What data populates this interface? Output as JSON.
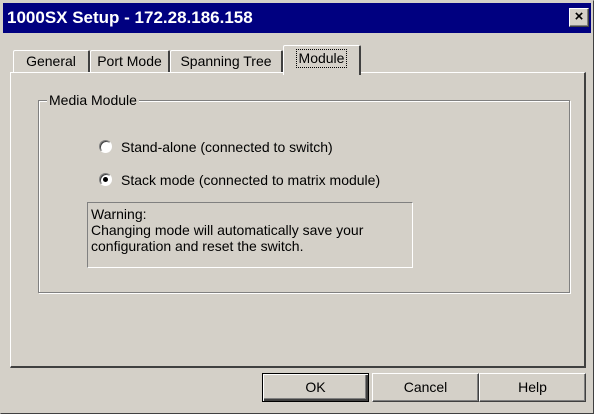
{
  "window": {
    "title": "1000SX Setup - 172.28.186.158",
    "close_glyph": "×"
  },
  "tabs": [
    {
      "label": "General",
      "active": false
    },
    {
      "label": "Port Mode",
      "active": false
    },
    {
      "label": "Spanning Tree",
      "active": false
    },
    {
      "label": "Module",
      "active": true
    }
  ],
  "media_module": {
    "group_label": "Media Module",
    "options": [
      {
        "label": "Stand-alone (connected to switch)",
        "selected": false
      },
      {
        "label": "Stack mode (connected to matrix module)",
        "selected": true
      }
    ],
    "warning": {
      "lines": [
        "Warning:",
        "Changing mode will automatically save your",
        "configuration and reset the switch."
      ]
    }
  },
  "buttons": {
    "ok": "OK",
    "cancel": "Cancel",
    "help": "Help"
  },
  "colors": {
    "title_bar": "#000080",
    "dialog_face": "#d4d0c8"
  }
}
